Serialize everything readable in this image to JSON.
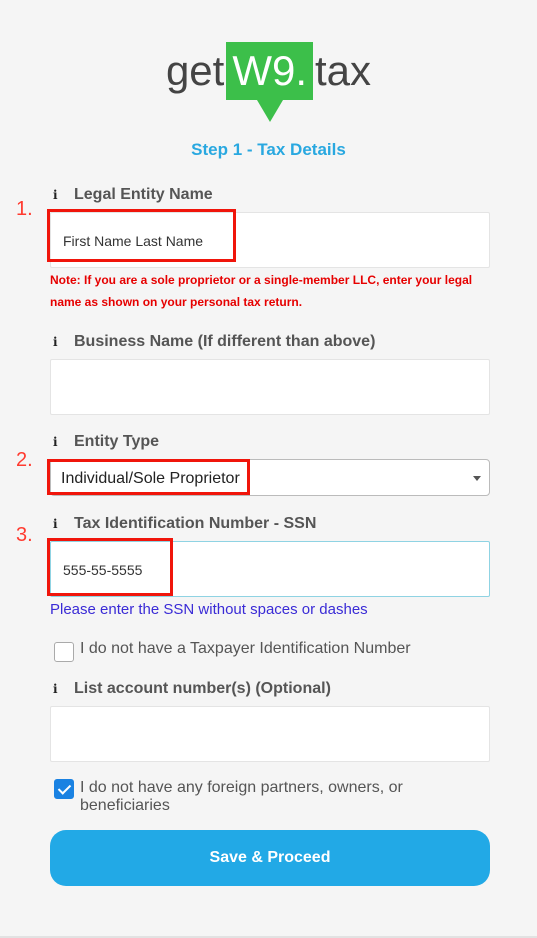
{
  "logo": {
    "left": "get",
    "box": "W9.",
    "right": "tax"
  },
  "step_title": "Step 1 - Tax Details",
  "annotations": {
    "n1": "1.",
    "n2": "2.",
    "n3": "3."
  },
  "info_icon": "i",
  "fields": {
    "legal_name": {
      "label": "Legal Entity Name",
      "value": "First Name Last Name"
    },
    "note": "Note: If you are a sole proprietor or a single-member LLC, enter your legal name as shown on your personal tax return.",
    "business_name": {
      "label": "Business Name (If different than above)",
      "value": ""
    },
    "entity_type": {
      "label": "Entity Type",
      "value": "Individual/Sole Proprietor"
    },
    "tin": {
      "label": "Tax Identification Number - SSN",
      "value": "555-55-5555",
      "hint": "Please enter the SSN without spaces or dashes"
    },
    "no_tin": {
      "label": "I do not have a Taxpayer Identification Number",
      "checked": false
    },
    "account_numbers": {
      "label": "List account number(s) (Optional)",
      "value": ""
    },
    "no_foreign": {
      "label": "I do not have any foreign partners, owners, or beneficiaries",
      "checked": true
    }
  },
  "save_button": "Save & Proceed",
  "colors": {
    "accent": "#29a8e0",
    "logo_green": "#3cbf4a",
    "button": "#22a9e6",
    "highlight": "#f0150b",
    "note": "#e60000"
  }
}
